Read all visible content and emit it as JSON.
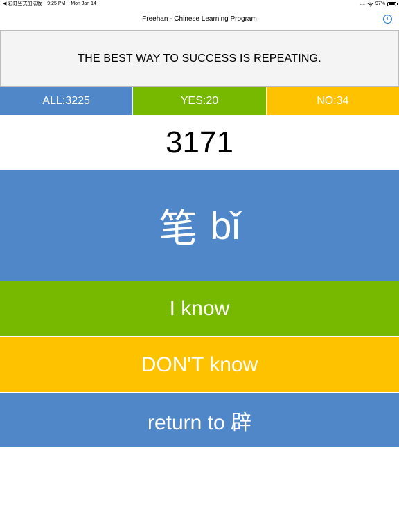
{
  "status_bar": {
    "back_app": "◀ 彩虹竖式加法版",
    "time": "9:25 PM",
    "date": "Mon Jan 14",
    "dots": "....",
    "battery": "97%"
  },
  "nav": {
    "title": "Freehan - Chinese Learning Program",
    "info_glyph": "i"
  },
  "motto": "THE BEST WAY TO SUCCESS IS REPEATING.",
  "stats": {
    "all": "ALL:3225",
    "yes": "YES:20",
    "no": "NO:34"
  },
  "counter": "3171",
  "card": {
    "hanzi": "笔",
    "pinyin": "bǐ"
  },
  "buttons": {
    "know": "I know",
    "dont_know": "DON'T know",
    "return": "return to 辟"
  },
  "colors": {
    "blue": "#5087c8",
    "green": "#77b800",
    "yellow": "#fec200",
    "info": "#1f7cf2"
  }
}
